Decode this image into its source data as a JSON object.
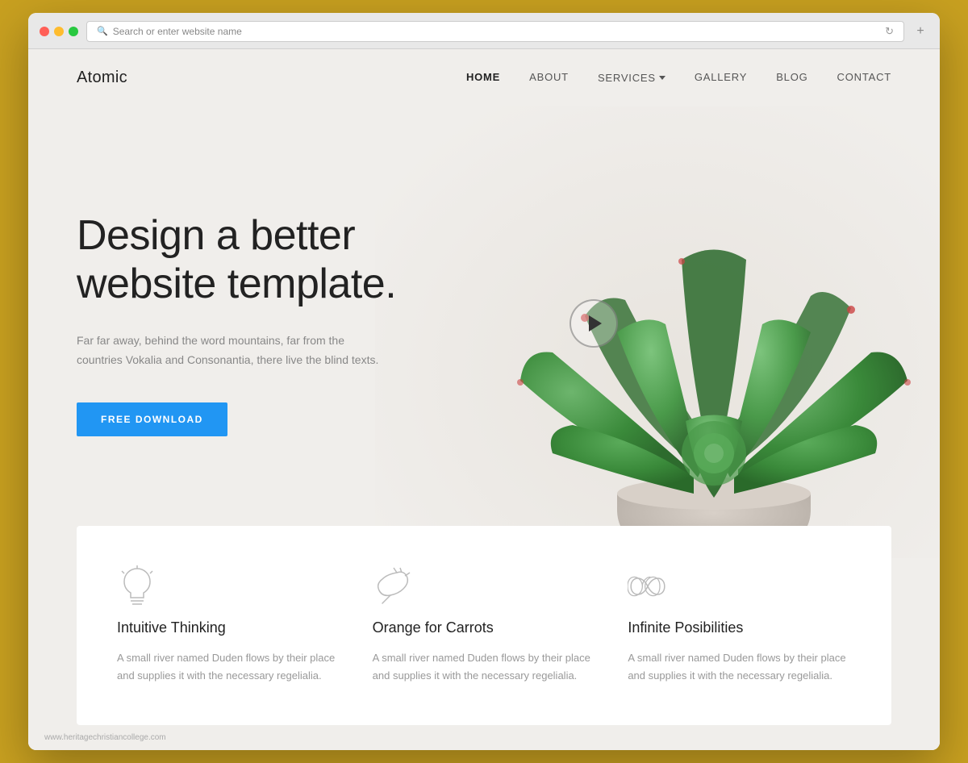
{
  "browser": {
    "address_placeholder": "Search or enter website name",
    "new_tab_icon": "+"
  },
  "nav": {
    "logo": "Atomic",
    "links": [
      {
        "label": "HOME",
        "active": true,
        "has_dropdown": false
      },
      {
        "label": "ABOUT",
        "active": false,
        "has_dropdown": false
      },
      {
        "label": "SERVICES",
        "active": false,
        "has_dropdown": true
      },
      {
        "label": "GALLERY",
        "active": false,
        "has_dropdown": false
      },
      {
        "label": "BLOG",
        "active": false,
        "has_dropdown": false
      },
      {
        "label": "CONTACT",
        "active": false,
        "has_dropdown": false
      }
    ]
  },
  "hero": {
    "title": "Design a better website template.",
    "subtitle": "Far far away, behind the word mountains, far from the countries Vokalia and Consonantia, there live the blind texts.",
    "cta_label": "FREE DOWNLOAD"
  },
  "features": [
    {
      "icon": "lightbulb",
      "title": "Intuitive Thinking",
      "description": "A small river named Duden flows by their place and supplies it with the necessary regelialia."
    },
    {
      "icon": "carrot",
      "title": "Orange for Carrots",
      "description": "A small river named Duden flows by their place and supplies it with the necessary regelialia."
    },
    {
      "icon": "infinity",
      "title": "Infinite Posibilities",
      "description": "A small river named Duden flows by their place and supplies it with the necessary regelialia."
    }
  ],
  "watermark": {
    "text": "www.heritagechristiancollege.com"
  },
  "colors": {
    "accent_blue": "#2196f3",
    "bg_light": "#f0eeeb",
    "text_dark": "#222222",
    "text_gray": "#888888",
    "nav_active": "#222222"
  }
}
